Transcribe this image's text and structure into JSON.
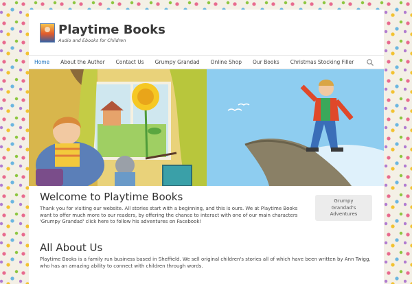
{
  "site": {
    "title": "Playtime Books",
    "tagline": "Audio and Ebooks for Children"
  },
  "nav": {
    "items": [
      {
        "label": "Home",
        "active": true
      },
      {
        "label": "About the Author"
      },
      {
        "label": "Contact Us"
      },
      {
        "label": "Grumpy Grandad"
      },
      {
        "label": "Online Shop"
      },
      {
        "label": "Our Books"
      },
      {
        "label": "Christmas Stocking Filler"
      }
    ],
    "search_icon": "search-icon"
  },
  "banner": {
    "left_scene": "girl-with-cat-by-window",
    "right_scene": "boy-on-cliff-rock"
  },
  "welcome": {
    "title": "Welcome to Playtime Books",
    "text": "Thank you for visiting our website. All stories start with a beginning, and this is ours. We at Playtime Books want to offer much more to our readers, by offering the chance to interact with one of our main characters 'Grumpy Grandad' click here to follow his adventures on Facebook!"
  },
  "cta": {
    "line1": "Grumpy",
    "line2": "Grandad's",
    "line3": "Adventures"
  },
  "about": {
    "title": "All About Us",
    "text": "Playtime Books is a family run business based in Sheffield. We sell original children's stories all of which have been written by Ann Twigg, who has an amazing ability to connect with children through words."
  },
  "colors": {
    "accent": "#1e73be",
    "text": "#444444"
  }
}
